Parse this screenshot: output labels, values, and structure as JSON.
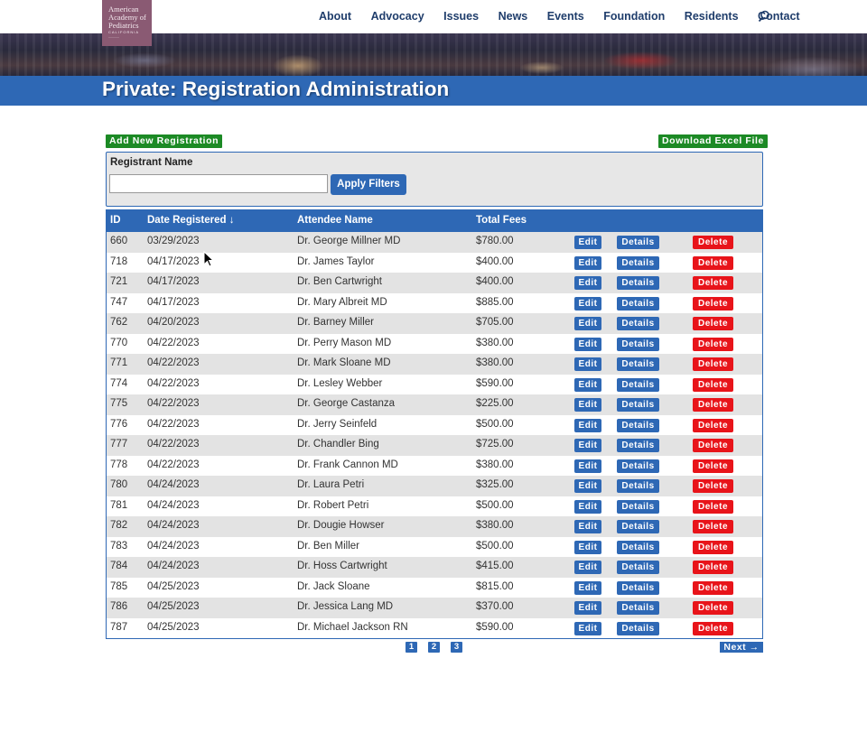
{
  "header": {
    "logo": {
      "line1": "American",
      "line2": "Academy of",
      "line3": "Pediatrics",
      "line4": "CALIFORNIA"
    },
    "nav": [
      "About",
      "Advocacy",
      "Issues",
      "News",
      "Events",
      "Foundation",
      "Residents",
      "Contact"
    ],
    "search_icon": "search-icon"
  },
  "page": {
    "title": "Private: Registration Administration"
  },
  "toolbar": {
    "add_label": "Add New Registration",
    "download_label": "Download Excel File"
  },
  "filter": {
    "label": "Registrant Name",
    "value": "",
    "apply_label": "Apply Filters"
  },
  "table": {
    "headers": {
      "id": "ID",
      "date": "Date Registered ↓",
      "name": "Attendee Name",
      "fees": "Total Fees"
    },
    "actions": {
      "edit": "Edit",
      "details": "Details",
      "delete": "Delete"
    },
    "rows": [
      {
        "id": "660",
        "date": "03/29/2023",
        "name": "Dr. George Millner MD",
        "fees": "$780.00"
      },
      {
        "id": "718",
        "date": "04/17/2023",
        "name": "Dr. James Taylor",
        "fees": "$400.00"
      },
      {
        "id": "721",
        "date": "04/17/2023",
        "name": "Dr. Ben Cartwright",
        "fees": "$400.00"
      },
      {
        "id": "747",
        "date": "04/17/2023",
        "name": "Dr. Mary Albreit MD",
        "fees": "$885.00"
      },
      {
        "id": "762",
        "date": "04/20/2023",
        "name": "Dr. Barney Miller",
        "fees": "$705.00"
      },
      {
        "id": "770",
        "date": "04/22/2023",
        "name": "Dr. Perry Mason MD",
        "fees": "$380.00"
      },
      {
        "id": "771",
        "date": "04/22/2023",
        "name": "Dr. Mark Sloane MD",
        "fees": "$380.00"
      },
      {
        "id": "774",
        "date": "04/22/2023",
        "name": "Dr. Lesley Webber",
        "fees": "$590.00"
      },
      {
        "id": "775",
        "date": "04/22/2023",
        "name": "Dr. George Castanza",
        "fees": "$225.00"
      },
      {
        "id": "776",
        "date": "04/22/2023",
        "name": "Dr. Jerry Seinfeld",
        "fees": "$500.00"
      },
      {
        "id": "777",
        "date": "04/22/2023",
        "name": "Dr. Chandler Bing",
        "fees": "$725.00"
      },
      {
        "id": "778",
        "date": "04/22/2023",
        "name": "Dr. Frank Cannon MD",
        "fees": "$380.00"
      },
      {
        "id": "780",
        "date": "04/24/2023",
        "name": "Dr. Laura Petri",
        "fees": "$325.00"
      },
      {
        "id": "781",
        "date": "04/24/2023",
        "name": "Dr. Robert Petri",
        "fees": "$500.00"
      },
      {
        "id": "782",
        "date": "04/24/2023",
        "name": "Dr. Dougie Howser",
        "fees": "$380.00"
      },
      {
        "id": "783",
        "date": "04/24/2023",
        "name": "Dr. Ben Miller",
        "fees": "$500.00"
      },
      {
        "id": "784",
        "date": "04/24/2023",
        "name": "Dr. Hoss Cartwright",
        "fees": "$415.00"
      },
      {
        "id": "785",
        "date": "04/25/2023",
        "name": "Dr. Jack Sloane",
        "fees": "$815.00"
      },
      {
        "id": "786",
        "date": "04/25/2023",
        "name": "Dr. Jessica Lang MD",
        "fees": "$370.00"
      },
      {
        "id": "787",
        "date": "04/25/2023",
        "name": "Dr. Michael Jackson RN",
        "fees": "$590.00"
      }
    ]
  },
  "pagination": {
    "pages": [
      "1",
      "2",
      "3"
    ],
    "next_label": "Next →"
  },
  "colors": {
    "primary_blue": "#2e68b5",
    "green": "#1c8a25",
    "red": "#e8141a",
    "nav_text": "#1f3d6b"
  }
}
